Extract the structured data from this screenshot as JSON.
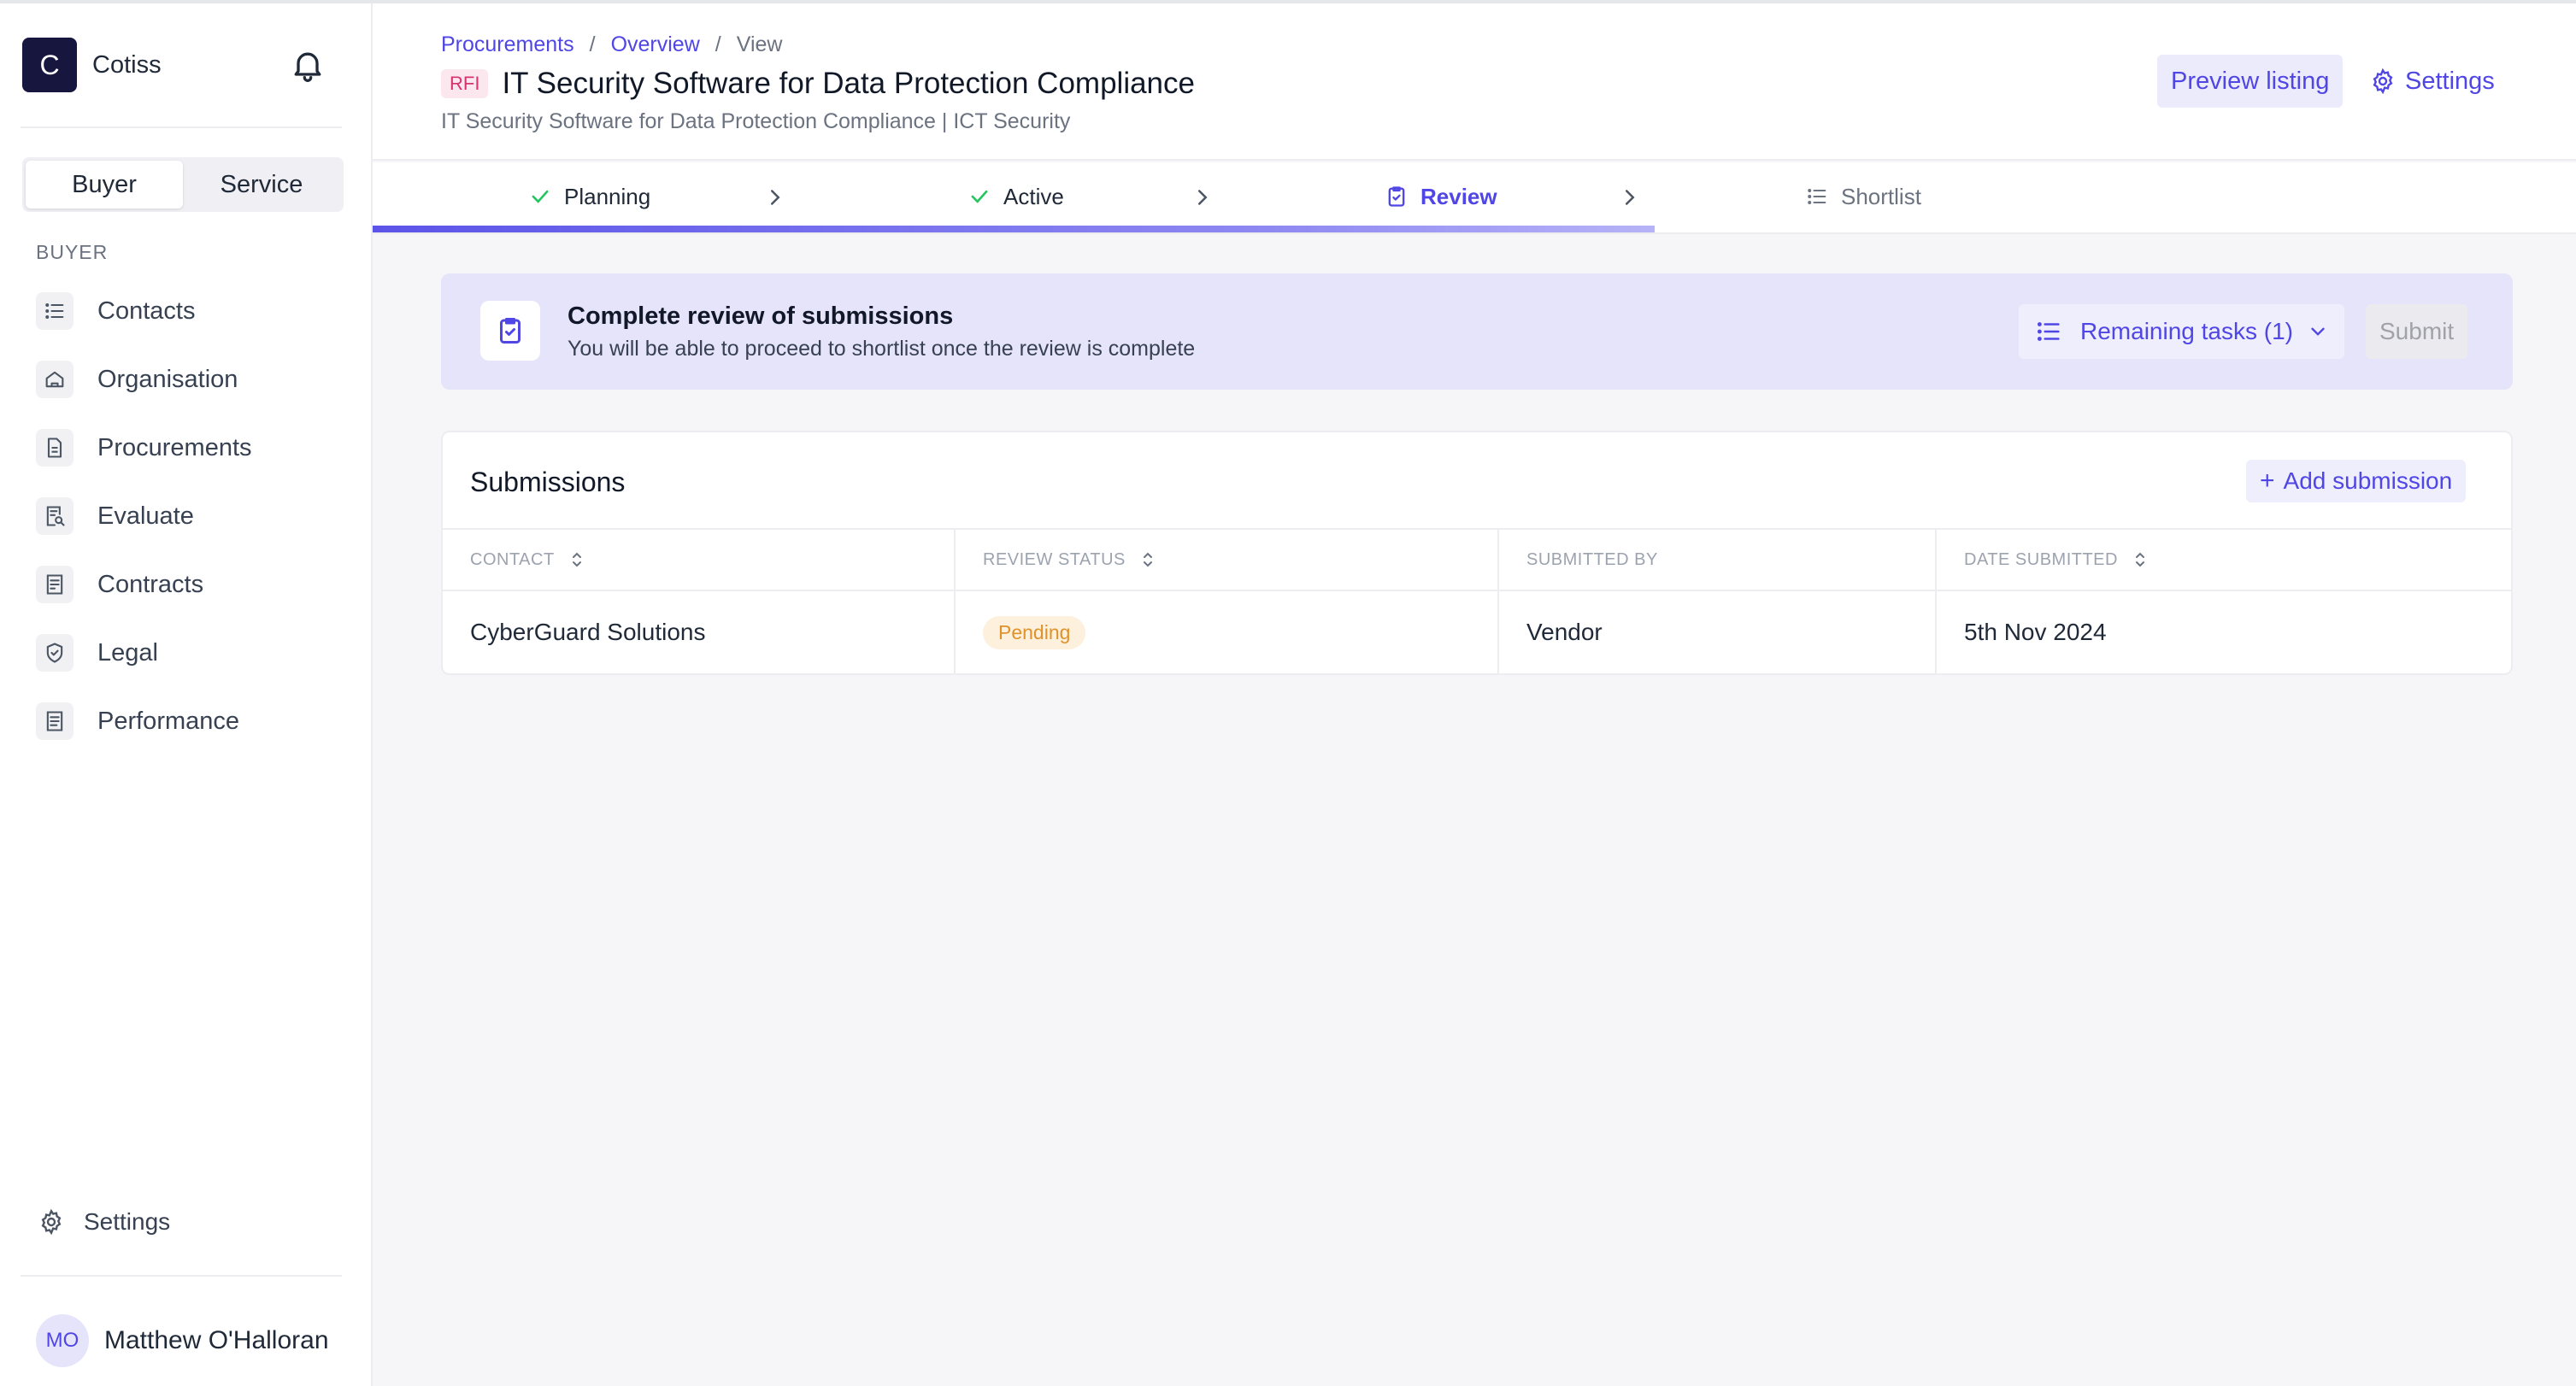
{
  "colors": {
    "accent": "#4f46e5",
    "brand_dark": "#16163f",
    "banner_bg": "#e6e4fb",
    "pending": "#e0922a",
    "success": "#22c55e"
  },
  "sidebar": {
    "brand_initial": "C",
    "brand_name": "Cotiss",
    "toggle": [
      {
        "label": "Buyer",
        "active": true
      },
      {
        "label": "Service",
        "active": false
      }
    ],
    "section_label": "BUYER",
    "items": [
      {
        "label": "Contacts",
        "icon": "list-icon"
      },
      {
        "label": "Organisation",
        "icon": "home-icon"
      },
      {
        "label": "Procurements",
        "icon": "document-icon"
      },
      {
        "label": "Evaluate",
        "icon": "document-search-icon"
      },
      {
        "label": "Contracts",
        "icon": "contract-icon"
      },
      {
        "label": "Legal",
        "icon": "shield-check-icon"
      },
      {
        "label": "Performance",
        "icon": "performance-icon"
      }
    ],
    "settings_label": "Settings",
    "user": {
      "initials": "MO",
      "name": "Matthew O'Halloran"
    }
  },
  "header": {
    "breadcrumbs": [
      "Procurements",
      "Overview",
      "View"
    ],
    "badge": "RFI",
    "title": "IT Security Software for Data Protection Compliance",
    "subtitle": "IT Security Software for Data Protection Compliance | ICT Security",
    "preview_label": "Preview listing",
    "settings_label": "Settings"
  },
  "stepper": {
    "steps": [
      {
        "label": "Planning",
        "state": "done"
      },
      {
        "label": "Active",
        "state": "done"
      },
      {
        "label": "Review",
        "state": "current"
      },
      {
        "label": "Shortlist",
        "state": "upcoming"
      }
    ]
  },
  "banner": {
    "title": "Complete review of submissions",
    "description": "You will be able to proceed to shortlist once the review is complete",
    "remaining_label": "Remaining tasks (1)",
    "submit_label": "Submit"
  },
  "submissions": {
    "title": "Submissions",
    "add_label": "Add submission",
    "columns": [
      "CONTACT",
      "REVIEW STATUS",
      "SUBMITTED BY",
      "DATE SUBMITTED"
    ],
    "rows": [
      {
        "contact": "CyberGuard Solutions",
        "status": "Pending",
        "submitted_by": "Vendor",
        "date": "5th Nov 2024"
      }
    ]
  }
}
